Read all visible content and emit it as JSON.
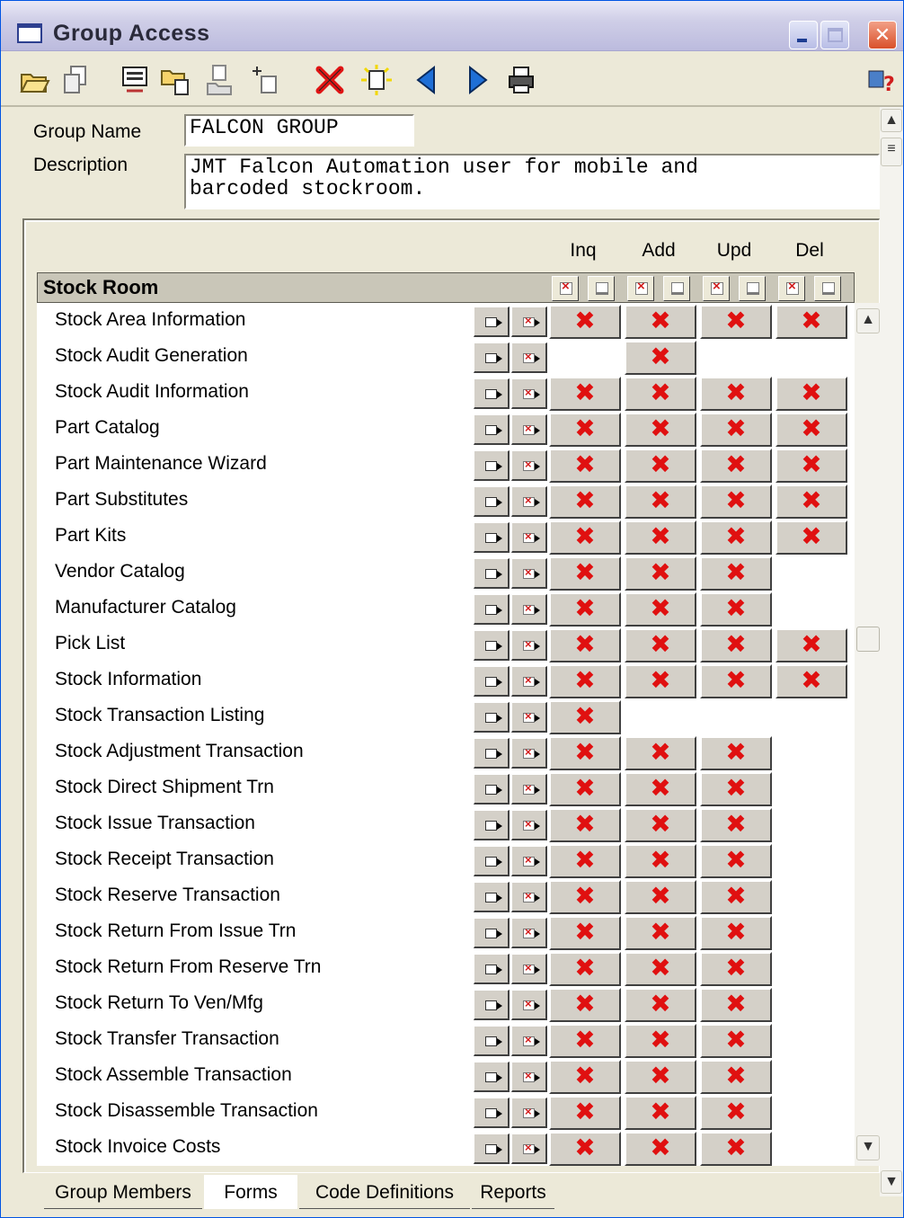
{
  "window": {
    "title": "Group Access"
  },
  "toolbar": {
    "icons": [
      "open-folder-icon",
      "copy-icon",
      "form-icon",
      "open-file-icon",
      "copy-multiple-icon",
      "add-icon",
      "delete-icon",
      "new-icon",
      "previous-icon",
      "next-icon",
      "print-icon",
      "help-icon"
    ]
  },
  "form": {
    "group_name_label": "Group Name",
    "group_name_value": "FALCON GROUP",
    "description_label": "Description",
    "description_value": "JMT Falcon Automation user for mobile and\nbarcoded stockroom."
  },
  "grid": {
    "columns": [
      "Inq",
      "Add",
      "Upd",
      "Del"
    ],
    "section_title": "Stock Room",
    "check_mark": "✖",
    "rows": [
      {
        "label": "Stock Area Information",
        "inq": true,
        "add": true,
        "upd": true,
        "del": true
      },
      {
        "label": "Stock Audit Generation",
        "inq": false,
        "add": true,
        "upd": false,
        "del": false
      },
      {
        "label": "Stock Audit Information",
        "inq": true,
        "add": true,
        "upd": true,
        "del": true
      },
      {
        "label": "Part Catalog",
        "inq": true,
        "add": true,
        "upd": true,
        "del": true
      },
      {
        "label": "Part Maintenance Wizard",
        "inq": true,
        "add": true,
        "upd": true,
        "del": true
      },
      {
        "label": "Part Substitutes",
        "inq": true,
        "add": true,
        "upd": true,
        "del": true
      },
      {
        "label": "Part Kits",
        "inq": true,
        "add": true,
        "upd": true,
        "del": true
      },
      {
        "label": "Vendor Catalog",
        "inq": true,
        "add": true,
        "upd": true,
        "del": false
      },
      {
        "label": "Manufacturer Catalog",
        "inq": true,
        "add": true,
        "upd": true,
        "del": false
      },
      {
        "label": "Pick List",
        "inq": true,
        "add": true,
        "upd": true,
        "del": true
      },
      {
        "label": "Stock Information",
        "inq": true,
        "add": true,
        "upd": true,
        "del": true
      },
      {
        "label": "Stock Transaction Listing",
        "inq": true,
        "add": false,
        "upd": false,
        "del": false
      },
      {
        "label": "Stock Adjustment Transaction",
        "inq": true,
        "add": true,
        "upd": true,
        "del": false
      },
      {
        "label": "Stock Direct Shipment Trn",
        "inq": true,
        "add": true,
        "upd": true,
        "del": false
      },
      {
        "label": "Stock Issue Transaction",
        "inq": true,
        "add": true,
        "upd": true,
        "del": false
      },
      {
        "label": "Stock Receipt Transaction",
        "inq": true,
        "add": true,
        "upd": true,
        "del": false
      },
      {
        "label": "Stock Reserve Transaction",
        "inq": true,
        "add": true,
        "upd": true,
        "del": false
      },
      {
        "label": "Stock Return From Issue Trn",
        "inq": true,
        "add": true,
        "upd": true,
        "del": false
      },
      {
        "label": "Stock Return From Reserve Trn",
        "inq": true,
        "add": true,
        "upd": true,
        "del": false
      },
      {
        "label": "Stock Return To Ven/Mfg",
        "inq": true,
        "add": true,
        "upd": true,
        "del": false
      },
      {
        "label": "Stock Transfer Transaction",
        "inq": true,
        "add": true,
        "upd": true,
        "del": false
      },
      {
        "label": "Stock Assemble Transaction",
        "inq": true,
        "add": true,
        "upd": true,
        "del": false
      },
      {
        "label": "Stock Disassemble Transaction",
        "inq": true,
        "add": true,
        "upd": true,
        "del": false
      },
      {
        "label": "Stock Invoice Costs",
        "inq": true,
        "add": true,
        "upd": true,
        "del": false
      }
    ]
  },
  "tabs": [
    {
      "label": "Group Members",
      "active": false
    },
    {
      "label": "Forms",
      "active": true
    },
    {
      "label": "Code Definitions",
      "active": false
    },
    {
      "label": "Reports",
      "active": false
    }
  ],
  "colors": {
    "check": "#e01010",
    "window_bg": "#ece9d8"
  }
}
